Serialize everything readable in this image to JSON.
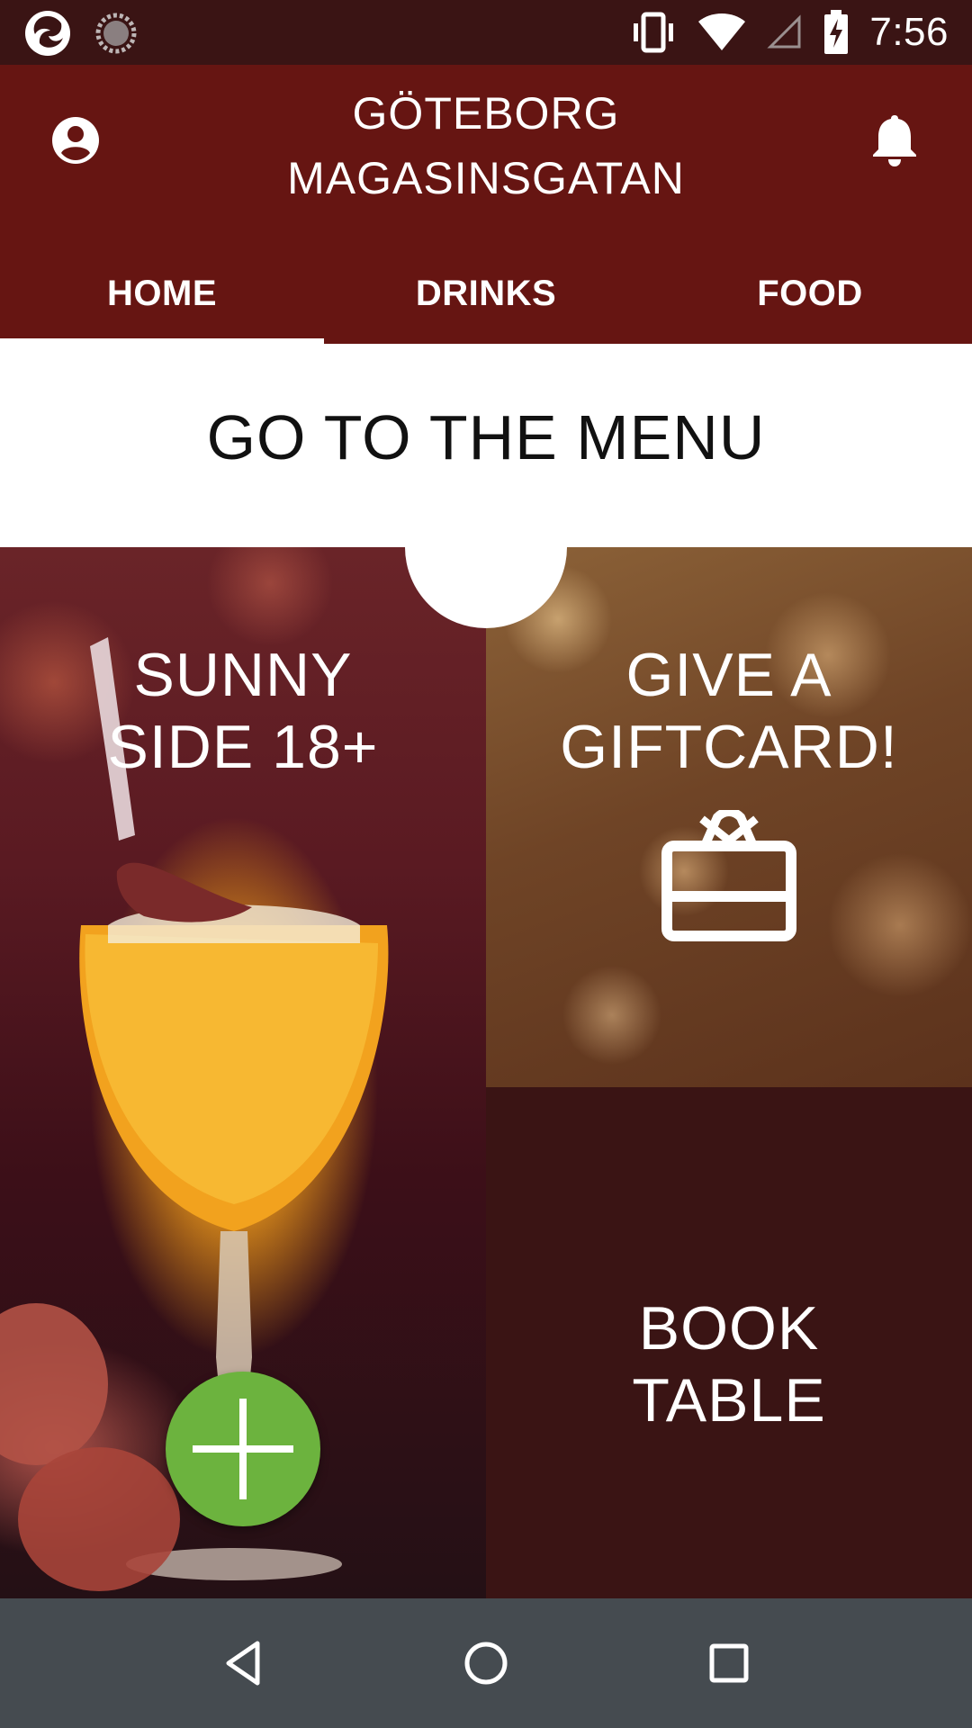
{
  "status_bar": {
    "time": "7:56",
    "left_icons": [
      "app-notification-icon",
      "sync-icon"
    ],
    "right_icons": [
      "vibrate-icon",
      "wifi-icon",
      "cellular-icon",
      "battery-charging-icon"
    ]
  },
  "header": {
    "location_line1": "GÖTEBORG",
    "location_line2": "MAGASINSGATAN",
    "profile_icon": "account-icon",
    "notification_icon": "bell-icon"
  },
  "tabs": [
    {
      "label": "HOME",
      "active": true
    },
    {
      "label": "DRINKS",
      "active": false
    },
    {
      "label": "FOOD",
      "active": false
    }
  ],
  "menu_banner": {
    "label": "GO TO THE MENU"
  },
  "tiles": {
    "sunny": {
      "line1": "SUNNY",
      "line2": "SIDE 18+"
    },
    "gift": {
      "line1": "GIVE A",
      "line2": "GIFTCARD!",
      "icon": "giftcard-icon"
    },
    "book": {
      "line1": "BOOK",
      "line2": "TABLE"
    }
  },
  "fab": {
    "icon": "plus-icon",
    "color": "#6cb33e"
  },
  "nav_bar": {
    "buttons": [
      "back-icon",
      "home-icon",
      "recents-icon"
    ]
  },
  "colors": {
    "header": "#661512",
    "status_bar": "#3a1414",
    "accent": "#6cb33e",
    "book_tile": "#3a1414",
    "nav_bar": "#454b50"
  }
}
